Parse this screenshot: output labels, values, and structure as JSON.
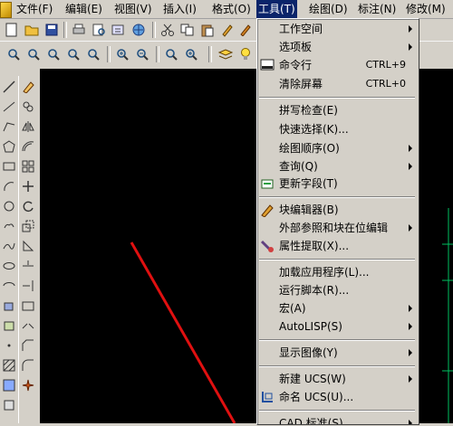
{
  "menubar": {
    "items": [
      {
        "label": "文件(F)"
      },
      {
        "label": "编辑(E)"
      },
      {
        "label": "视图(V)"
      },
      {
        "label": "插入(I)"
      },
      {
        "label": "格式(O)"
      },
      {
        "label": "工具(T)"
      },
      {
        "label": "绘图(D)"
      },
      {
        "label": "标注(N)"
      },
      {
        "label": "修改(M)"
      }
    ]
  },
  "tools_menu": {
    "items": [
      {
        "label": "工作空间",
        "submenu": true
      },
      {
        "label": "选项板",
        "submenu": true
      },
      {
        "label": "命令行",
        "shortcut": "CTRL+9",
        "icon": "command-line-icon"
      },
      {
        "label": "清除屏幕",
        "shortcut": "CTRL+0"
      },
      {
        "label": "拼写检查(E)"
      },
      {
        "label": "快速选择(K)..."
      },
      {
        "label": "绘图顺序(O)",
        "submenu": true
      },
      {
        "label": "查询(Q)",
        "submenu": true
      },
      {
        "label": "更新字段(T)",
        "icon": "update-field-icon"
      },
      {
        "label": "块编辑器(B)",
        "icon": "block-editor-icon"
      },
      {
        "label": "外部参照和块在位编辑",
        "submenu": true
      },
      {
        "label": "属性提取(X)...",
        "icon": "attribute-extract-icon"
      },
      {
        "label": "加载应用程序(L)..."
      },
      {
        "label": "运行脚本(R)..."
      },
      {
        "label": "宏(A)",
        "submenu": true
      },
      {
        "label": "AutoLISP(S)",
        "submenu": true
      },
      {
        "label": "显示图像(Y)",
        "submenu": true
      },
      {
        "label": "新建 UCS(W)",
        "submenu": true
      },
      {
        "label": "命名 UCS(U)...",
        "icon": "named-ucs-icon"
      },
      {
        "label": "CAD 标准(S)",
        "submenu": true
      }
    ]
  },
  "colors": {
    "accent": "#0a246a",
    "canvas": "#000000",
    "line": "#e01010",
    "dimension": "#00c060"
  }
}
